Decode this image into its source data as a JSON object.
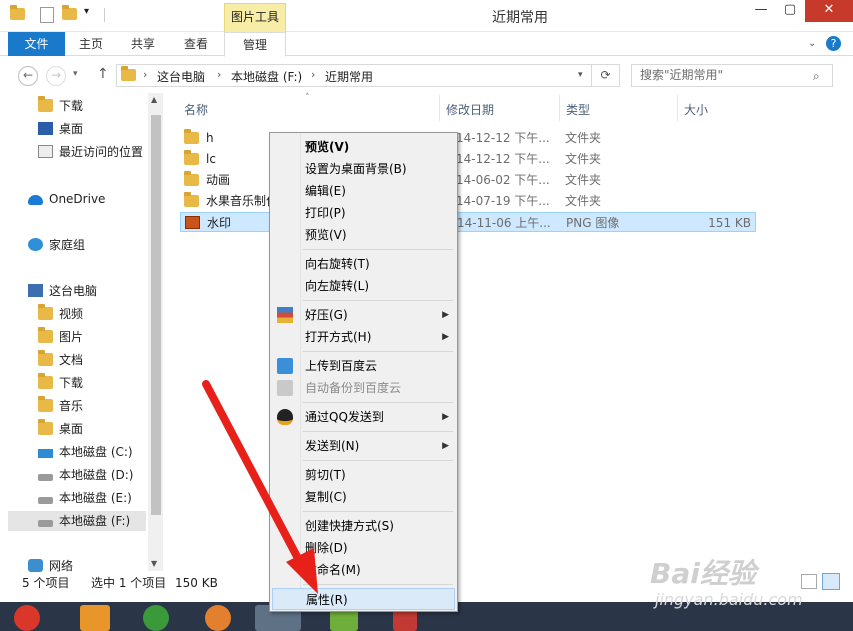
{
  "window": {
    "title": "近期常用",
    "context_tab_group": "图片工具"
  },
  "ribbon": {
    "tabs": [
      "文件",
      "主页",
      "共享",
      "查看",
      "管理"
    ]
  },
  "address": {
    "crumbs": [
      "这台电脑",
      "本地磁盘 (F:)",
      "近期常用"
    ],
    "search_placeholder": "搜索\"近期常用\""
  },
  "nav": {
    "items": [
      "下载",
      "桌面",
      "最近访问的位置",
      "OneDrive",
      "家庭组",
      "这台电脑",
      "视频",
      "图片",
      "文档",
      "下载",
      "音乐",
      "桌面",
      "本地磁盘 (C:)",
      "本地磁盘 (D:)",
      "本地磁盘 (E:)",
      "本地磁盘 (F:)",
      "网络"
    ]
  },
  "columns": [
    "名称",
    "修改日期",
    "类型",
    "大小"
  ],
  "files": [
    {
      "name": "h",
      "date": "14-12-12 下午...",
      "type": "文件夹",
      "size": ""
    },
    {
      "name": "lc",
      "date": "14-12-12 下午...",
      "type": "文件夹",
      "size": ""
    },
    {
      "name": "动画",
      "date": "14-06-02 下午...",
      "type": "文件夹",
      "size": ""
    },
    {
      "name": "水果音乐制作",
      "date": "14-07-19 下午...",
      "type": "文件夹",
      "size": ""
    },
    {
      "name": "水印",
      "date": "14-11-06 上午...",
      "type": "PNG 图像",
      "size": "151 KB"
    }
  ],
  "status": {
    "count": "5 个项目",
    "selected": "选中 1 个项目",
    "size": "150 KB"
  },
  "menu": {
    "items": [
      "预览(V)",
      "设置为桌面背景(B)",
      "编辑(E)",
      "打印(P)",
      "预览(V)",
      "向右旋转(T)",
      "向左旋转(L)",
      "好压(G)",
      "打开方式(H)",
      "上传到百度云",
      "自动备份到百度云",
      "通过QQ发送到",
      "发送到(N)",
      "剪切(T)",
      "复制(C)",
      "创建快捷方式(S)",
      "删除(D)",
      "重命名(M)",
      "属性(R)"
    ]
  },
  "watermark": {
    "brand": "Bai经验",
    "url": "jingyan.baidu.com"
  },
  "colors": {
    "accent": "#1979ca",
    "selection": "#cde8ff",
    "arrow": "#e8201a"
  }
}
